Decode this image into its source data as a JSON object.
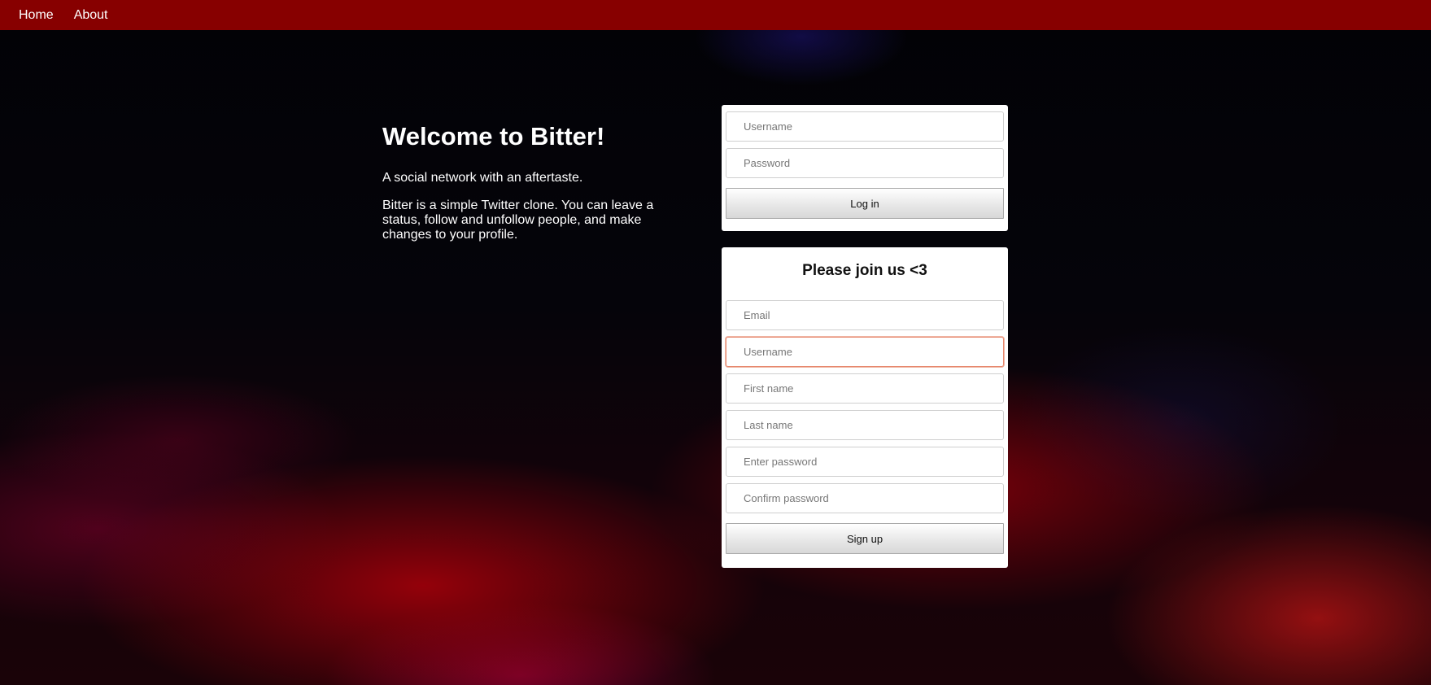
{
  "nav": {
    "items": [
      {
        "label": "Home"
      },
      {
        "label": "About"
      }
    ]
  },
  "intro": {
    "title": "Welcome to Bitter!",
    "tagline": "A social network with an aftertaste.",
    "description": "Bitter is a simple Twitter clone. You can leave a status, follow and unfollow people, and make changes to your profile."
  },
  "login": {
    "username_placeholder": "Username",
    "password_placeholder": "Password",
    "submit_label": "Log in"
  },
  "signup": {
    "title": "Please join us <3",
    "email_placeholder": "Email",
    "username_placeholder": "Username",
    "first_name_placeholder": "First name",
    "last_name_placeholder": "Last name",
    "password_placeholder": "Enter password",
    "confirm_password_placeholder": "Confirm password",
    "submit_label": "Sign up"
  },
  "colors": {
    "navbar": "#870000",
    "invalid_border": "#e7896f",
    "card": "#ffffff"
  }
}
